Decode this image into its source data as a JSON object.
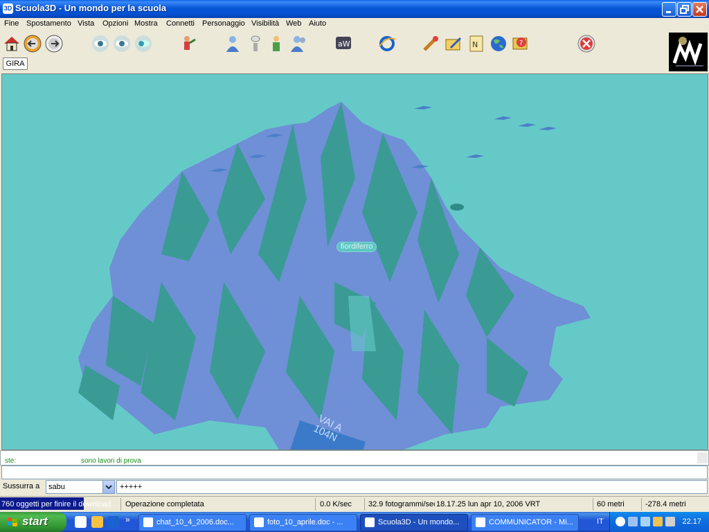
{
  "window": {
    "title": "Scuola3D - Un mondo per la scuola",
    "app_icon_text": "3D"
  },
  "menu": [
    "Fine",
    "Spostamento",
    "Vista",
    "Opzioni",
    "Mostra",
    "Connetti",
    "Personaggio",
    "Visibilità",
    "Web",
    "Aiuto"
  ],
  "toolbar": {
    "icons": [
      "home-icon",
      "back-icon",
      "forward-icon",
      "eye-icon",
      "eye-icon",
      "eye-icon",
      "gesture-icon",
      "avatar-icon",
      "visibility-icon",
      "user-icon",
      "users-icon",
      "aw-icon",
      "internet-explorer-icon",
      "tools-icon",
      "edit-icon",
      "notes-icon",
      "globe-icon",
      "help-icon",
      "stop-icon"
    ],
    "gira_label": "GIRA"
  },
  "viewport": {
    "avatar_label": "fiordiferro",
    "sign_text_1": "VAI A",
    "sign_text_2": "104N"
  },
  "chat": {
    "nick": "ste:",
    "message": "sono lavori di prova"
  },
  "whisper": {
    "label": "Sussurra a",
    "selected": "sabu",
    "input_value": "+++++"
  },
  "status": {
    "progress_text": "760 oggetti per finire il download",
    "operation": "Operazione completata",
    "speed": "0.0 K/sec",
    "fps": "32.9 fotogrammi/sec",
    "datetime": "18.17.25 lun apr 10, 2006 VRT",
    "altitude": "60 metri",
    "position": "-278.4 metri"
  },
  "taskbar": {
    "start_label": "start",
    "tasks": [
      "chat_10_4_2006.doc...",
      "foto_10_aprile.doc - ...",
      "Scuola3D - Un mondo...",
      "COMMUNICATOR - Mi..."
    ],
    "language": "IT",
    "clock": "22.17"
  },
  "colors": {
    "viewport_bg": "#65c9c8",
    "terrain_blue": "#6f8fd6",
    "terrain_teal": "#3a9b95",
    "chat_text": "#128c12"
  }
}
